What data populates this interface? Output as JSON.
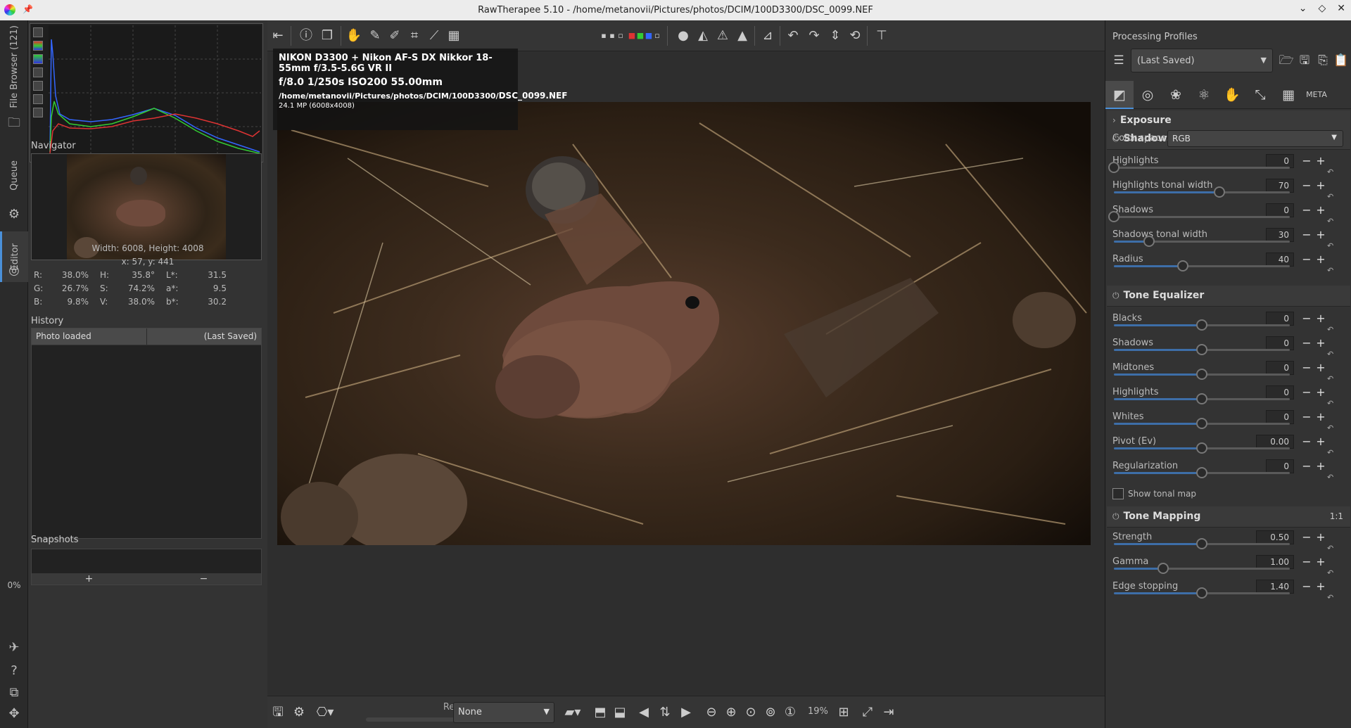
{
  "window": {
    "title": "RawTherapee 5.10 - /home/metanovii/Pictures/photos/DCIM/100D3300/DSC_0099.NEF"
  },
  "vtabs": {
    "file_browser": "File Browser (121)",
    "queue": "Queue",
    "editor": "Editor",
    "progress": "0%"
  },
  "left": {
    "navigator_label": "Navigator",
    "dimensions": "Width: 6008, Height: 4008",
    "coords": "x: 57, y: 441",
    "pixel": {
      "r_label": "R:",
      "r": "38.0%",
      "h_label": "H:",
      "h": "35.8°",
      "l_label": "L*:",
      "l": "31.5",
      "g_label": "G:",
      "g": "26.7%",
      "s_label": "S:",
      "s": "74.2%",
      "a_label": "a*:",
      "a": "9.5",
      "b_label": "B:",
      "b": "9.8%",
      "v_label": "V:",
      "v": "38.0%",
      "bb_label": "b*:",
      "bb": "30.2"
    },
    "history_label": "History",
    "history": [
      {
        "action": "Photo loaded",
        "value": "(Last Saved)"
      }
    ],
    "snapshots_label": "Snapshots",
    "snap_add": "+",
    "snap_remove": "−"
  },
  "overlay": {
    "camera": "NIKON D3300 + Nikon AF-S DX Nikkor 18-55mm f/3.5-5.6G VR II",
    "exposure": "f/8.0  1/250s  ISO200  55.00mm",
    "path_prefix": "/home/metanovii/Pictures/photos/DCIM/100D3300/",
    "filename": "DSC_0099.NEF",
    "megapixels": "24.1 MP (6008x4008)"
  },
  "bottom": {
    "status": "Ready",
    "output_profile": "None",
    "zoom": "19%"
  },
  "right": {
    "processing_profiles_label": "Processing Profiles",
    "profile_value": "(Last Saved)",
    "sections": {
      "exposure": "Exposure",
      "shadows_highlights": "Shadows/Highlights",
      "tone_equalizer": "Tone Equalizer",
      "tone_mapping": "Tone Mapping",
      "tone_mapping_ratio": "1:1"
    },
    "color_space_label": "Color space:",
    "color_space_value": "RGB",
    "sh": [
      {
        "label": "Highlights",
        "value": "0",
        "pos": 0
      },
      {
        "label": "Highlights tonal width",
        "value": "70",
        "pos": 0.6
      },
      {
        "label": "Shadows",
        "value": "0",
        "pos": 0
      },
      {
        "label": "Shadows tonal width",
        "value": "30",
        "pos": 0.2
      },
      {
        "label": "Radius",
        "value": "40",
        "pos": 0.39
      }
    ],
    "te": [
      {
        "label": "Blacks",
        "value": "0",
        "pos": 0.5
      },
      {
        "label": "Shadows",
        "value": "0",
        "pos": 0.5
      },
      {
        "label": "Midtones",
        "value": "0",
        "pos": 0.5
      },
      {
        "label": "Highlights",
        "value": "0",
        "pos": 0.5
      },
      {
        "label": "Whites",
        "value": "0",
        "pos": 0.5
      },
      {
        "label": "Pivot (Ev)",
        "value": "0.00",
        "pos": 0.5
      },
      {
        "label": "Regularization",
        "value": "0",
        "pos": 0.5
      }
    ],
    "show_tonal_map": "Show tonal map",
    "tm": [
      {
        "label": "Strength",
        "value": "0.50",
        "pos": 0.5
      },
      {
        "label": "Gamma",
        "value": "1.00",
        "pos": 0.28
      },
      {
        "label": "Edge stopping",
        "value": "1.40",
        "pos": 0.5
      }
    ]
  }
}
